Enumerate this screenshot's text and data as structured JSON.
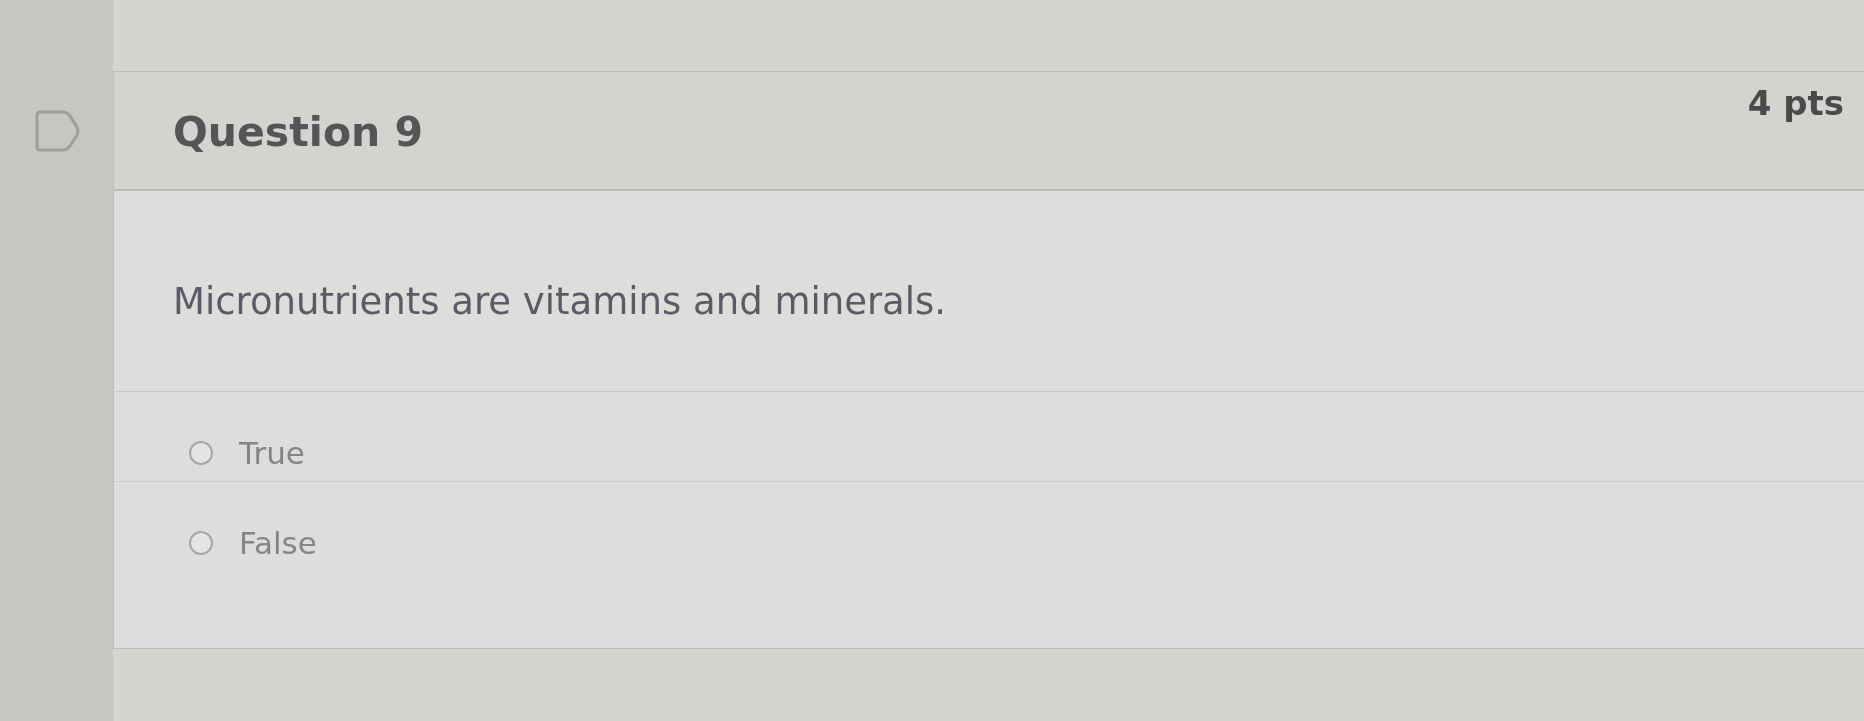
{
  "question": {
    "flagged": false,
    "title": "Question 9",
    "points": "4 pts"
  },
  "prompt": "Micronutrients are vitamins and minerals.",
  "answers": [
    {
      "label": "True",
      "selected": false
    },
    {
      "label": "False",
      "selected": false
    }
  ]
}
